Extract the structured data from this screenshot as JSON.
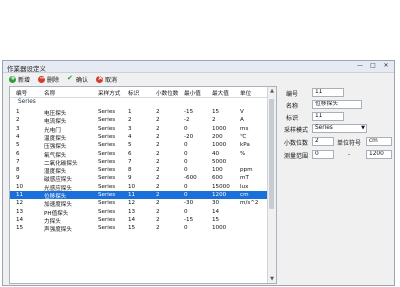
{
  "window": {
    "title": "作業器设定义",
    "controls": [
      "—",
      "□",
      "✕"
    ]
  },
  "toolbar": {
    "new_label": "新增",
    "delete_label": "删除",
    "confirm_label": "确认",
    "cancel_label": "取消"
  },
  "table": {
    "headers": [
      "编号",
      "名称",
      "采样方式",
      "标识",
      "小数位数",
      "最小值",
      "最大值",
      "单位"
    ],
    "group_label": "Series",
    "rows": [
      [
        "1",
        "电压探头",
        "Series",
        "1",
        "2",
        "-15",
        "15",
        "V"
      ],
      [
        "2",
        "电流探头",
        "Series",
        "2",
        "2",
        "-2",
        "2",
        "A"
      ],
      [
        "3",
        "光电门",
        "Series",
        "3",
        "2",
        "0",
        "1000",
        "ms"
      ],
      [
        "4",
        "温度探头",
        "Series",
        "4",
        "2",
        "-20",
        "200",
        "℃"
      ],
      [
        "5",
        "压强探头",
        "Series",
        "5",
        "2",
        "0",
        "1000",
        "kPa"
      ],
      [
        "6",
        "氧气探头",
        "Series",
        "6",
        "2",
        "0",
        "40",
        "%"
      ],
      [
        "7",
        "二氧化碳探头",
        "Series",
        "7",
        "2",
        "0",
        "5000",
        ""
      ],
      [
        "8",
        "湿度探头",
        "Series",
        "8",
        "2",
        "0",
        "100",
        "ppm"
      ],
      [
        "9",
        "磁感应探头",
        "Series",
        "9",
        "2",
        "-600",
        "600",
        "mT"
      ],
      [
        "10",
        "光感应探头",
        "Series",
        "10",
        "2",
        "0",
        "15000",
        "lux"
      ],
      [
        "11",
        "位移探头",
        "Series",
        "11",
        "2",
        "0",
        "1200",
        "cm"
      ],
      [
        "12",
        "加速度探头",
        "Series",
        "12",
        "2",
        "-30",
        "30",
        "m/s^2"
      ],
      [
        "13",
        "PH值探头",
        "Series",
        "13",
        "2",
        "0",
        "14",
        ""
      ],
      [
        "14",
        "力探头",
        "Series",
        "14",
        "2",
        "-15",
        "15",
        ""
      ],
      [
        "15",
        "声强度探头",
        "Series",
        "15",
        "2",
        "0",
        "1000",
        ""
      ]
    ],
    "selected_index": 10
  },
  "properties": {
    "id_label": "编号",
    "id_value": "11",
    "name_label": "名称",
    "name_value": "位移探头",
    "tag_label": "标识",
    "tag_value": "11",
    "mode_label": "采样模式",
    "mode_value": "Series",
    "decimals_label": "小数位数",
    "decimals_value": "2",
    "unit_label": "单位符号",
    "unit_value": "cm",
    "range_label": "测量范围",
    "range_min": "0",
    "range_sep": "-",
    "range_max": "1200"
  }
}
